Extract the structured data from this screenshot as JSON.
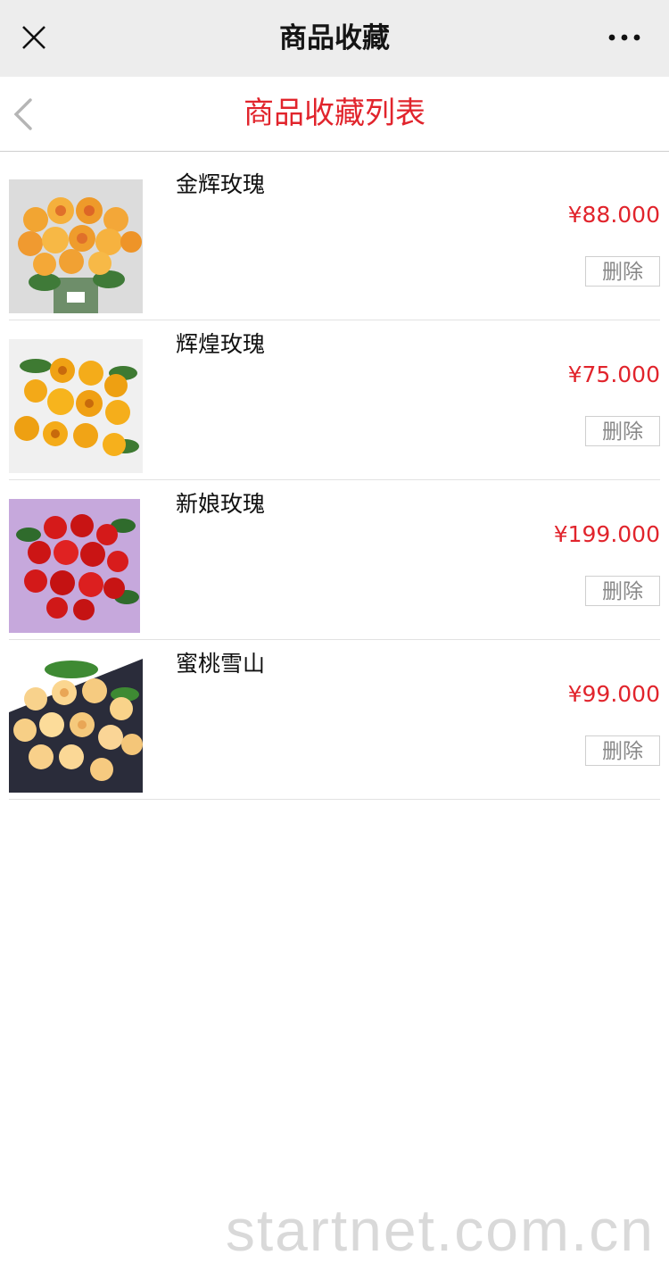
{
  "topbar": {
    "title": "商品收藏",
    "close_icon": "close-icon",
    "more_icon": "more-icon"
  },
  "header": {
    "title": "商品收藏列表",
    "back_icon": "chevron-left-icon"
  },
  "items": [
    {
      "name": "金辉玫瑰",
      "price": "¥88.000",
      "delete_label": "删除",
      "image": "orange-rose-bouquet"
    },
    {
      "name": "辉煌玫瑰",
      "price": "¥75.000",
      "delete_label": "删除",
      "image": "yellow-orange-roses"
    },
    {
      "name": "新娘玫瑰",
      "price": "¥199.000",
      "delete_label": "删除",
      "image": "red-rose-bouquet"
    },
    {
      "name": "蜜桃雪山",
      "price": "¥99.000",
      "delete_label": "删除",
      "image": "peach-roses"
    }
  ],
  "watermark": "startnet.com.cn",
  "colors": {
    "accent": "#e1242c",
    "topbar_bg": "#ededed",
    "divider": "#e2e2e2"
  }
}
